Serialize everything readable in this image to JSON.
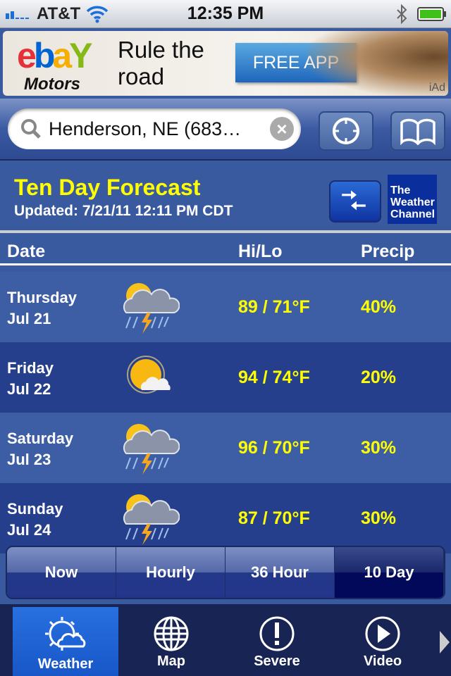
{
  "status": {
    "carrier": "AT&T",
    "time": "12:35 PM"
  },
  "ad": {
    "brand": "ebay",
    "brand_sub": "Motors",
    "tagline_1": "Rule the",
    "tagline_2": "road",
    "cta": "FREE APP",
    "badge": "iAd"
  },
  "search": {
    "value": "Henderson, NE (683…",
    "placeholder": ""
  },
  "header": {
    "title": "Ten Day Forecast",
    "updated": "Updated: 7/21/11 12:11 PM CDT",
    "logo": "The Weather Channel",
    "logo_1": "The",
    "logo_2": "Weather",
    "logo_3": "Channel"
  },
  "columns": {
    "date": "Date",
    "hilo": "Hi/Lo",
    "precip": "Precip"
  },
  "forecast": [
    {
      "day": "Thursday",
      "date": "Jul 21",
      "icon": "thunderstorm-icon",
      "hilo": "89 / 71°F",
      "precip": "40%"
    },
    {
      "day": "Friday",
      "date": "Jul 22",
      "icon": "mostly-sunny-icon",
      "hilo": "94 / 74°F",
      "precip": "20%"
    },
    {
      "day": "Saturday",
      "date": "Jul 23",
      "icon": "thunderstorm-icon",
      "hilo": "96 / 70°F",
      "precip": "30%"
    },
    {
      "day": "Sunday",
      "date": "Jul 24",
      "icon": "thunderstorm-icon",
      "hilo": "87 / 70°F",
      "precip": "30%"
    }
  ],
  "segments": [
    {
      "label": "Now"
    },
    {
      "label": "Hourly"
    },
    {
      "label": "36 Hour"
    },
    {
      "label": "10 Day",
      "selected": true
    }
  ],
  "tabs": [
    {
      "label": "Weather",
      "icon": "sun-cloud-icon",
      "selected": true
    },
    {
      "label": "Map",
      "icon": "globe-icon"
    },
    {
      "label": "Severe",
      "icon": "alert-icon"
    },
    {
      "label": "Video",
      "icon": "play-icon"
    }
  ],
  "colors": {
    "accent_yellow": "#ffff00",
    "row_light": "#3d5ea5",
    "row_dark": "#263f8c",
    "tab_selected": "#1f64d6"
  }
}
